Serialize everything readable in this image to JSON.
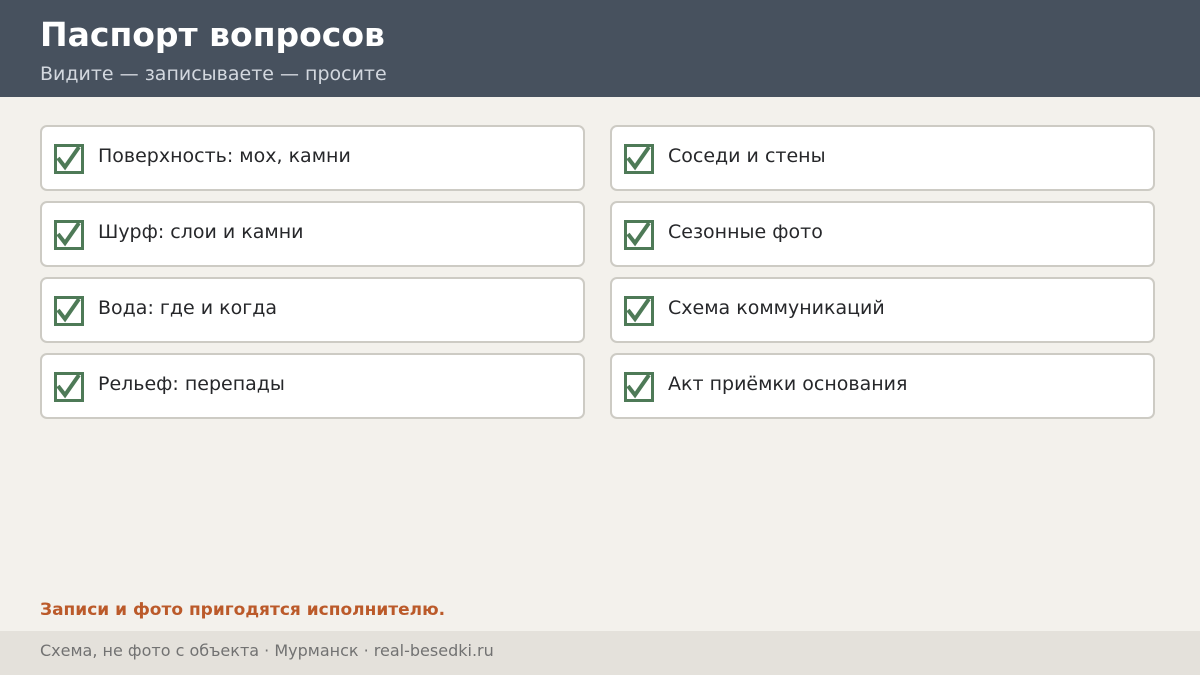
{
  "header": {
    "title": "Паспорт вопросов",
    "subtitle": "Видите — записываете — просите"
  },
  "checklist": {
    "left": [
      {
        "label": "Поверхность: мох, камни",
        "checked": true
      },
      {
        "label": "Шурф: слои и камни",
        "checked": true
      },
      {
        "label": "Вода: где и когда",
        "checked": true
      },
      {
        "label": "Рельеф: перепады",
        "checked": true
      }
    ],
    "right": [
      {
        "label": "Соседи и стены",
        "checked": true
      },
      {
        "label": "Сезонные фото",
        "checked": true
      },
      {
        "label": "Схема коммуникаций",
        "checked": true
      },
      {
        "label": "Акт приёмки основания",
        "checked": true
      }
    ]
  },
  "note": "Записи и фото пригодятся исполнителю.",
  "footer": {
    "text": "Схема, не фото с объекта  ·  Мурманск  ·  real-besedki.ru"
  },
  "colors": {
    "header_bg": "#47515e",
    "check_green": "#4e7a57",
    "note_accent": "#bb5a2a"
  }
}
